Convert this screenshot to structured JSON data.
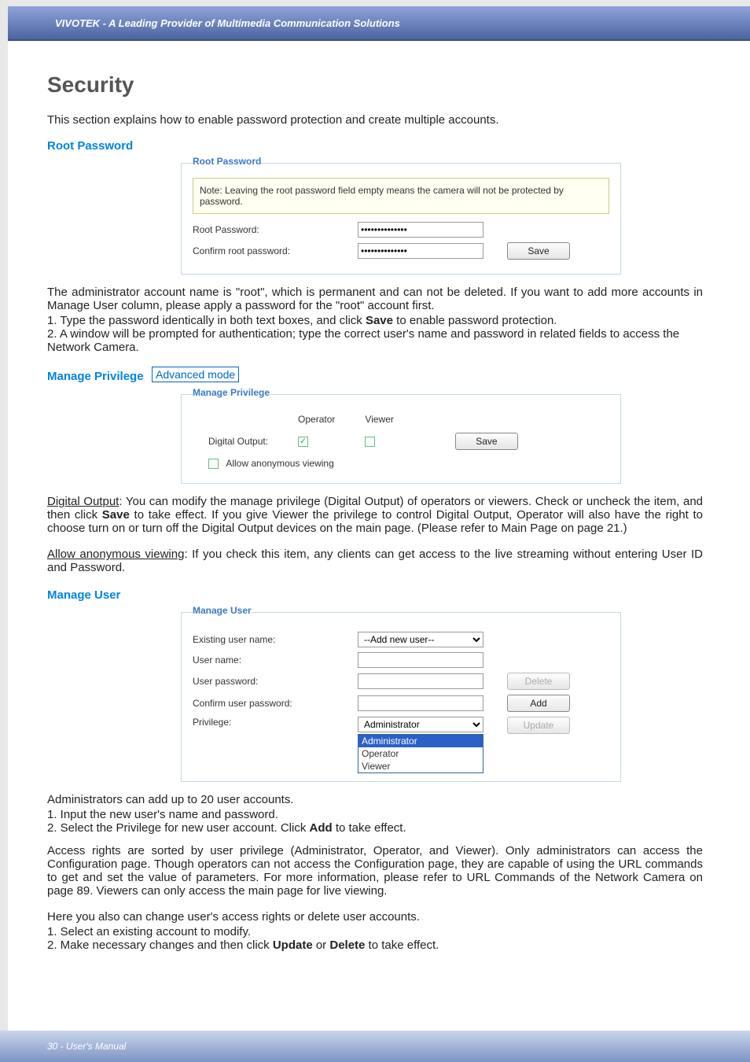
{
  "topbar": {
    "brand": "VIVOTEK - A Leading Provider of Multimedia Communication Solutions"
  },
  "title": "Security",
  "intro": "This section explains how to enable password protection and create multiple accounts.",
  "root_password": {
    "heading": "Root Password",
    "legend": "Root Password",
    "note": "Note: Leaving the root password field empty means the camera will not be protected by password.",
    "label_root": "Root Password:",
    "label_confirm": "Confirm root password:",
    "masked": "••••••••••••••",
    "save_btn": "Save"
  },
  "root_para1": "The administrator account name is \"root\", which is permanent and can not be deleted. If you want to add more accounts in Manage User column, please apply a password for the \"root\" account first.",
  "root_step1_a": "1. Type the password identically in both text boxes, and click ",
  "root_step1_b": "Save",
  "root_step1_c": " to enable password protection.",
  "root_step2": "2. A window will be prompted for authentication; type the correct user's name and password in related fields to access the Network Camera.",
  "manage_priv": {
    "heading": "Manage Privilege",
    "adv": "Advanced mode",
    "legend": "Manage Privilege",
    "col_operator": "Operator",
    "col_viewer": "Viewer",
    "row_do": "Digital Output:",
    "allow_anon": "Allow anonymous viewing",
    "save_btn": "Save"
  },
  "priv_para1_a": "Digital Output",
  "priv_para1_b": ": You can modify the manage privilege (Digital Output) of operators or viewers. Check or uncheck the item, and then click ",
  "priv_para1_c": "Save",
  "priv_para1_d": " to take effect. If you give Viewer the privilege to control Digital Output, Operator will also have the right to choose turn on or turn off the Digital Output devices on the main page. (Please refer to Main Page on page 21.)",
  "priv_para2_a": "Allow anonymous viewing",
  "priv_para2_b": ": If you check this item, any clients can get access to the live streaming without entering User ID and Password.",
  "manage_user": {
    "heading": "Manage User",
    "legend": "Manage User",
    "lbl_existing": "Existing user name:",
    "lbl_username": "User name:",
    "lbl_userpass": "User password:",
    "lbl_confirm": "Confirm user password:",
    "lbl_priv": "Privilege:",
    "sel_addnew": "--Add new user--",
    "sel_priv": "Administrator",
    "opts": {
      "admin": "Administrator",
      "operator": "Operator",
      "viewer": "Viewer"
    },
    "btn_delete": "Delete",
    "btn_add": "Add",
    "btn_update": "Update"
  },
  "mu_para1": "Administrators can add up to 20 user accounts.",
  "mu_step1": "1. Input the new user's name and password.",
  "mu_step2_a": "2. Select the Privilege for new user account. Click ",
  "mu_step2_b": "Add",
  "mu_step2_c": " to take effect.",
  "mu_para2": "Access rights are sorted by user privilege (Administrator, Operator, and Viewer). Only administrators can access the Configuration page. Though operators can not access the Configuration page, they are capable of using the URL commands to get and set the value of parameters. For more information, please refer to URL Commands of the Network Camera on page 89. Viewers can only access the main page for live viewing.",
  "mu_para3": "Here you also can change user's access rights or delete user accounts.",
  "mu_step3": "1. Select an existing account to modify.",
  "mu_step4_a": "2. Make necessary changes and then click ",
  "mu_step4_b": "Update",
  "mu_step4_c": " or ",
  "mu_step4_d": "Delete",
  "mu_step4_e": " to take effect.",
  "footer": {
    "pagenum": "30 - User's Manual"
  }
}
